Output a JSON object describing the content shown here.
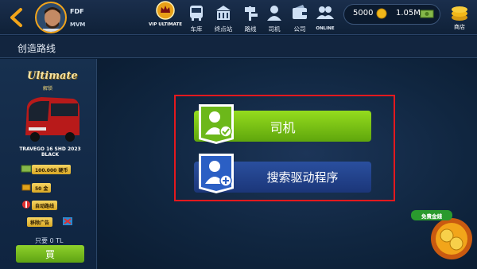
{
  "player": {
    "name": "FDF",
    "tag": "MVM"
  },
  "nav": {
    "vip_label": "VIP ULTIMATE",
    "items": [
      {
        "label": "车库",
        "icon": "bus-icon"
      },
      {
        "label": "终点站",
        "icon": "terminal-building-icon"
      },
      {
        "label": "路线",
        "icon": "route-sign-icon"
      },
      {
        "label": "司机",
        "icon": "driver-icon"
      },
      {
        "label": "公司",
        "icon": "company-wallet-icon"
      },
      {
        "label": "ONLINE",
        "icon": "online-users-icon"
      }
    ]
  },
  "currency": {
    "coins": "5000",
    "cash": "1.05M"
  },
  "shop_label": "商店",
  "page_title": "创造路线",
  "side": {
    "ultimate": "Ultimate",
    "unlocked": "解锁",
    "bus_model": "TRAVEGO 16 SHD 2023 BLACK",
    "rewards": [
      "100.000 硬币",
      "50 金",
      "自动路线",
      "移除广告"
    ],
    "price": "只要 0 TL",
    "buy_label": "買"
  },
  "actions": {
    "driver_label": "司机",
    "search_label": "搜索驱动程序"
  },
  "free_cash_label": "免費金錢",
  "colors": {
    "accent_red": "#e3191e",
    "green": "#7cc41a",
    "blue": "#23438c",
    "gold": "#f2a51a"
  }
}
